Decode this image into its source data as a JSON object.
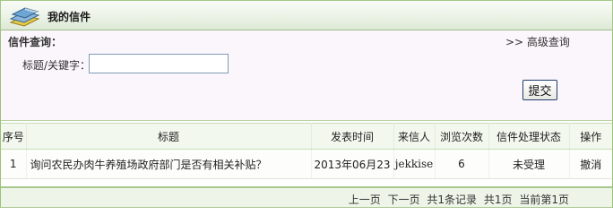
{
  "header": {
    "title": "我的信件"
  },
  "search": {
    "label": "信件查询：",
    "advanced_link": ">> 高级查询",
    "keyword_label": "标题/关键字：",
    "keyword_value": "",
    "submit_label": "提交"
  },
  "table": {
    "columns": [
      "序号",
      "标题",
      "发表时间",
      "来信人",
      "浏览次数",
      "信件处理状态",
      "操作"
    ],
    "rows": [
      {
        "no": "1",
        "subject": "询问农民办肉牛养殖场政府部门是否有相关补贴？",
        "date": "2013年06月23",
        "sender": "jekkise",
        "views": "6",
        "status": "未受理",
        "action": "撤消"
      }
    ]
  },
  "pager": {
    "prev": "上一页",
    "next": "下一页",
    "total_records": "共1条记录",
    "total_pages": "共1页",
    "current_page": "当前第1页"
  },
  "colors": {
    "border": "#9bc278",
    "header_bg": "#e8f1e2",
    "search_bg": "#fbf6fb"
  }
}
